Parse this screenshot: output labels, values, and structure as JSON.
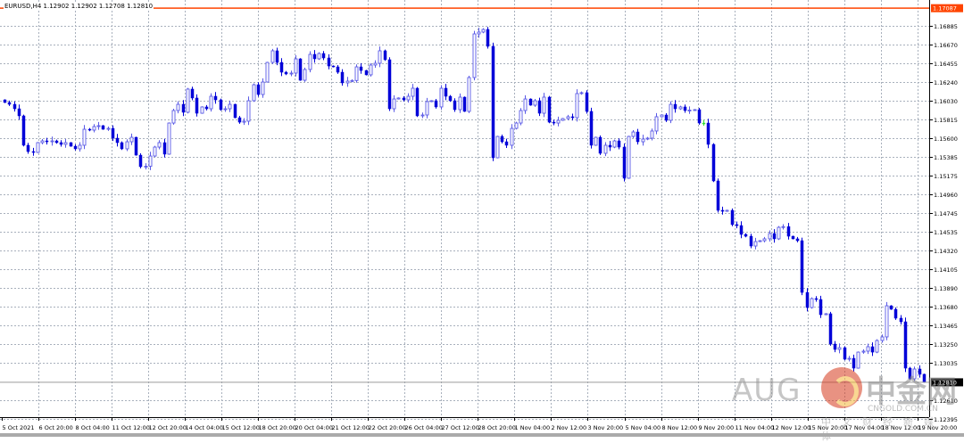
{
  "header": {
    "symbol": "EURUSD,H4",
    "open": "1.12902",
    "high": "1.12902",
    "low": "1.12708",
    "close": "1.12810"
  },
  "colors": {
    "bull": "#5a5ae6",
    "bear": "#0000d8",
    "doji": "#33dd33",
    "grid": "#a8b0bc",
    "alert_line": "#ff4400",
    "price_line": "#9a9a9a"
  },
  "alert_level": "1.17087",
  "current_price": "1.12810",
  "watermark": {
    "brand": "AUG",
    "cn_name": "中金网",
    "site": "CNGOLD.COM.CN",
    "slogan": "中文财经新媒体"
  },
  "chart_data": {
    "type": "candlestick",
    "title": "EURUSD,H4",
    "ylim": [
      1.12395,
      1.17087
    ],
    "yticks": [
      "1.16885",
      "1.16670",
      "1.16455",
      "1.16240",
      "1.16030",
      "1.15815",
      "1.15600",
      "1.15385",
      "1.15175",
      "1.14960",
      "1.14745",
      "1.14535",
      "1.14320",
      "1.14105",
      "1.13890",
      "1.13680",
      "1.13465",
      "1.13250",
      "1.13035",
      "1.12810",
      "1.12610",
      "1.12395"
    ],
    "xticks": [
      "5 Oct 2021",
      "6 Oct 20:00",
      "8 Oct 04:00",
      "11 Oct 12:00",
      "12 Oct 20:00",
      "14 Oct 04:00",
      "15 Oct 12:00",
      "18 Oct 20:00",
      "20 Oct 04:00",
      "21 Oct 12:00",
      "22 Oct 20:00",
      "26 Oct 04:00",
      "27 Oct 12:00",
      "28 Oct 20:00",
      "1 Nov 04:00",
      "2 Nov 12:00",
      "3 Nov 20:00",
      "5 Nov 04:00",
      "8 Nov 12:00",
      "9 Nov 20:00",
      "11 Nov 04:00",
      "12 Nov 12:00",
      "15 Nov 20:00",
      "17 Nov 04:00",
      "18 Nov 12:00",
      "19 Nov 20:00"
    ],
    "first_open": 1.16039,
    "closes": [
      1.16009,
      1.15988,
      1.15937,
      1.15856,
      1.1552,
      1.15448,
      1.15438,
      1.1555,
      1.1557,
      1.1556,
      1.1557,
      1.1555,
      1.1553,
      1.1555,
      1.15509,
      1.15479,
      1.1552,
      1.15703,
      1.15693,
      1.15734,
      1.15744,
      1.15703,
      1.15713,
      1.15601,
      1.1555,
      1.15479,
      1.1556,
      1.15611,
      1.15407,
      1.15275,
      1.1528,
      1.15397,
      1.15499,
      1.1555,
      1.15418,
      1.15774,
      1.15917,
      1.15988,
      1.15897,
      1.16162,
      1.1606,
      1.15886,
      1.15958,
      1.15937,
      1.1608,
      1.16039,
      1.15927,
      1.15937,
      1.15988,
      1.15835,
      1.15784,
      1.15795,
      1.16029,
      1.16212,
      1.161,
      1.16243,
      1.16467,
      1.166,
      1.16467,
      1.16355,
      1.16335,
      1.16345,
      1.16508,
      1.16263,
      1.16386,
      1.16559,
      1.16508,
      1.16569,
      1.16518,
      1.16426,
      1.16416,
      1.16355,
      1.16233,
      1.16253,
      1.1626,
      1.16416,
      1.16375,
      1.16325,
      1.16437,
      1.16457,
      1.166,
      1.16498,
      1.15937,
      1.16049,
      1.1606,
      1.16039,
      1.1608,
      1.16172,
      1.15856,
      1.15866,
      1.16019,
      1.16029,
      1.15958,
      1.16172,
      1.1608,
      1.16029,
      1.15927,
      1.1607,
      1.15907,
      1.16294,
      1.16793,
      1.16814,
      1.16844,
      1.16651,
      1.15377,
      1.15621,
      1.1556,
      1.1552,
      1.15713,
      1.15774,
      1.15917,
      1.16049,
      1.15978,
      1.16029,
      1.15886,
      1.1607,
      1.15784,
      1.15774,
      1.15805,
      1.15825,
      1.15846,
      1.15835,
      1.16111,
      1.16121,
      1.15907,
      1.1552,
      1.15611,
      1.15428,
      1.1552,
      1.15499,
      1.1557,
      1.15499,
      1.15143,
      1.15621,
      1.15672,
      1.1556,
      1.15591,
      1.15601,
      1.15683,
      1.15846,
      1.15866,
      1.15805,
      1.15988,
      1.15937,
      1.15958,
      1.15917,
      1.15922,
      1.15927,
      1.15774,
      1.15774,
      1.1553,
      1.15112,
      1.14776,
      1.14765,
      1.14776,
      1.14613,
      1.14602,
      1.14501,
      1.1448,
      1.14368,
      1.14419,
      1.14429,
      1.1445,
      1.14511,
      1.1445,
      1.14582,
      1.1459,
      1.1448,
      1.1445,
      1.14429,
      1.13838,
      1.13665,
      1.13767,
      1.13757,
      1.13583,
      1.13594,
      1.13247,
      1.13186,
      1.13206,
      1.13074,
      1.13084,
      1.12972,
      1.13155,
      1.13166,
      1.13217,
      1.13155,
      1.13288,
      1.13329,
      1.13685,
      1.13645,
      1.13543,
      1.13502,
      1.12972,
      1.1285,
      1.12962,
      1.12902,
      1.1281
    ]
  }
}
